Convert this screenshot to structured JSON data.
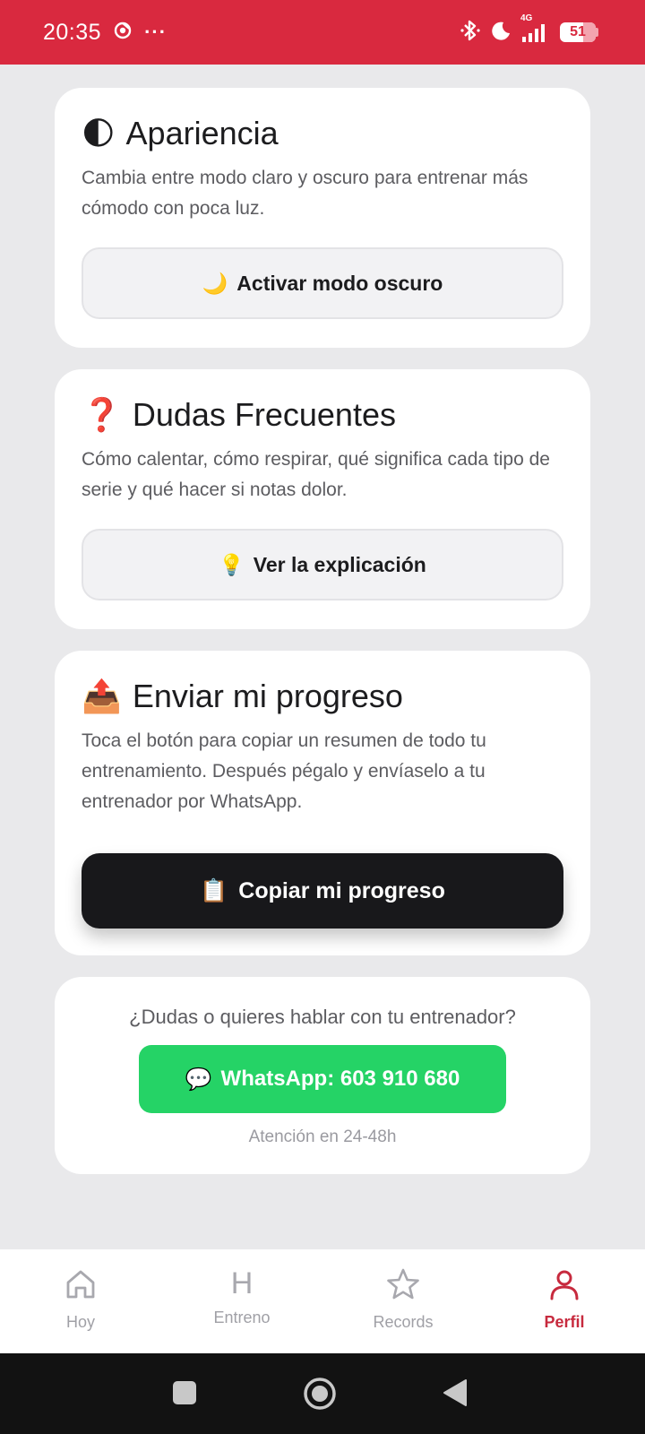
{
  "status_bar": {
    "time": "20:35",
    "more": "···",
    "network": "4G",
    "battery": "51"
  },
  "appearance": {
    "title": "Apariencia",
    "title_emoji": "🌓",
    "description": "Cambia entre modo claro y oscuro para entrenar más cómodo con poca luz.",
    "button_emoji": "🌙",
    "button_label": "Activar modo oscuro"
  },
  "faq": {
    "title": "Dudas Frecuentes",
    "title_emoji": "❓",
    "description": "Cómo calentar, cómo respirar, qué significa cada tipo de serie y qué hacer si notas dolor.",
    "button_emoji": "💡",
    "button_label": "Ver la explicación"
  },
  "progress": {
    "title": "Enviar mi progreso",
    "title_emoji": "📤",
    "description": "Toca el botón para copiar un resumen de todo tu entrenamiento. Después pégalo y envíaselo a tu entrenador por WhatsApp.",
    "button_emoji": "📋",
    "button_label": "Copiar mi progreso"
  },
  "contact": {
    "question": "¿Dudas o quieres hablar con tu entrenador?",
    "whatsapp_emoji": "💬",
    "whatsapp_label": "WhatsApp: 603 910 680",
    "note": "Atención en 24-48h"
  },
  "bottom_nav": {
    "items": [
      {
        "label": "Hoy",
        "icon": "home-icon"
      },
      {
        "label": "Entreno",
        "icon": "H"
      },
      {
        "label": "Records",
        "icon": "star-icon"
      },
      {
        "label": "Perfil",
        "icon": "user-icon"
      }
    ],
    "active": "Perfil"
  },
  "colors": {
    "status_bar": "#d9293f",
    "accent": "#c72a3e",
    "whatsapp": "#25d366",
    "dark_button": "#18181b"
  }
}
